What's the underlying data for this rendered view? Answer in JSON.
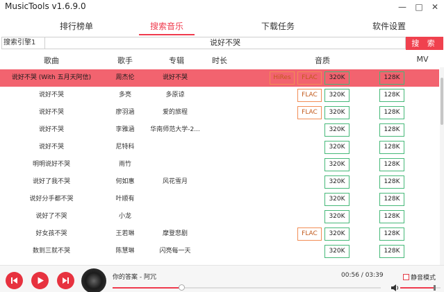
{
  "app": {
    "title": "MusicTools v1.6.9.0"
  },
  "window": {
    "minimize": "—",
    "maximize": "□",
    "close": "✕"
  },
  "tabs": [
    {
      "label": "排行榜单",
      "active": false
    },
    {
      "label": "搜索音乐",
      "active": true
    },
    {
      "label": "下载任务",
      "active": false
    },
    {
      "label": "软件设置",
      "active": false
    }
  ],
  "search": {
    "engine": "搜索引擎1",
    "query": "说好不哭",
    "button": "搜 索"
  },
  "columns": {
    "song": "歌曲",
    "singer": "歌手",
    "album": "专辑",
    "duration": "时长",
    "quality": "音质",
    "mv": "MV"
  },
  "rows": [
    {
      "song": "说好不哭 (With 五月天阿信)",
      "singer": "周杰伦",
      "album": "说好不哭",
      "hires": "HiRes",
      "flac": "FLAC",
      "q320": "320K",
      "q128": "128K",
      "selected": true
    },
    {
      "song": "说好不哭",
      "singer": "多亮",
      "album": "多原谅",
      "hires": "",
      "flac": "FLAC",
      "q320": "320K",
      "q128": "128K"
    },
    {
      "song": "说好不哭",
      "singer": "廖羽涵",
      "album": "爱的旅程",
      "hires": "",
      "flac": "FLAC",
      "q320": "320K",
      "q128": "128K"
    },
    {
      "song": "说好不哭",
      "singer": "李雅涵",
      "album": "华南师范大学-2...",
      "hires": "",
      "flac": "",
      "q320": "320K",
      "q128": "128K"
    },
    {
      "song": "说好不哭",
      "singer": "尼特科",
      "album": "",
      "hires": "",
      "flac": "",
      "q320": "320K",
      "q128": "128K"
    },
    {
      "song": "明明说好不哭",
      "singer": "雨竹",
      "album": "",
      "hires": "",
      "flac": "",
      "q320": "320K",
      "q128": "128K"
    },
    {
      "song": "说好了我不哭",
      "singer": "何如惠",
      "album": "风花雪月",
      "hires": "",
      "flac": "",
      "q320": "320K",
      "q128": "128K"
    },
    {
      "song": "说好分手都不哭",
      "singer": "叶顺有",
      "album": "",
      "hires": "",
      "flac": "",
      "q320": "320K",
      "q128": "128K"
    },
    {
      "song": "说好了不哭",
      "singer": "小龙",
      "album": "",
      "hires": "",
      "flac": "",
      "q320": "320K",
      "q128": "128K"
    },
    {
      "song": "好女孩不哭",
      "singer": "王若琳",
      "album": "摩登悲剧",
      "hires": "",
      "flac": "FLAC",
      "q320": "320K",
      "q128": "128K"
    },
    {
      "song": "数到三就不哭",
      "singer": "陈慧琳",
      "album": "闪亮每一天",
      "hires": "",
      "flac": "",
      "q320": "320K",
      "q128": "128K"
    }
  ],
  "player": {
    "now_playing": "你的答案 - 阿冗",
    "time": "00:56 / 03:39",
    "progress": 0.256,
    "mute_label": "静音模式",
    "volume": 0.85
  },
  "colors": {
    "accent": "#ef3a4d",
    "selected_row": "#f2636f",
    "quality_orange": "#f28d55",
    "quality_green": "#45b878"
  },
  "icons": {
    "prev": "skip-previous-icon",
    "play": "play-icon",
    "next": "skip-next-icon",
    "volume": "volume-icon"
  }
}
